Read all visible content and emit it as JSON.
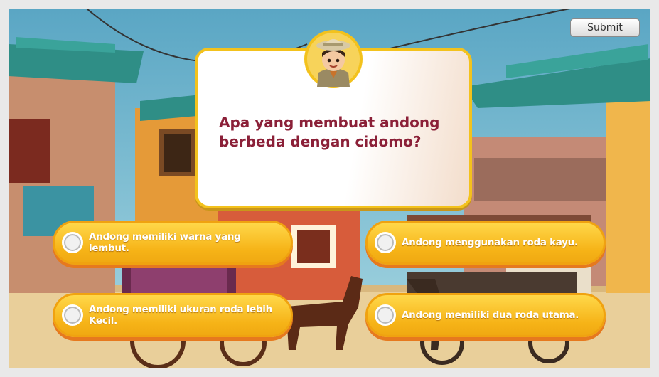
{
  "submit_label": "Submit",
  "question": "Apa yang membuat andong berbeda dengan cidomo?",
  "options": [
    {
      "label": "Andong memiliki warna yang lembut."
    },
    {
      "label": "Andong menggunakan roda kayu."
    },
    {
      "label": "Andong memiliki ukuran roda lebih Kecil."
    },
    {
      "label": "Andong memiliki dua roda utama."
    }
  ],
  "colors": {
    "question_text": "#8b2038",
    "card_border": "#f3c21d",
    "option_fill": "#f6b317",
    "option_shadow": "#e6791e"
  }
}
